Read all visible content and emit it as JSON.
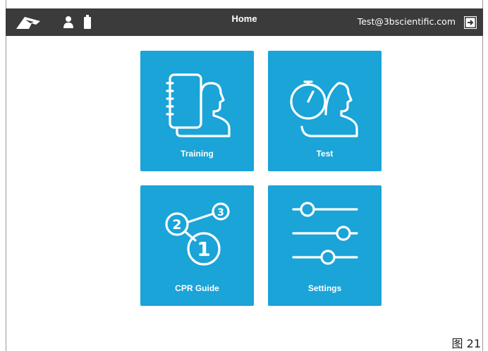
{
  "header": {
    "title": "Home",
    "email": "Test@3bscientific.com"
  },
  "tiles": [
    {
      "label": "Training",
      "icon": "training-icon"
    },
    {
      "label": "Test",
      "icon": "test-icon"
    },
    {
      "label": "CPR Guide",
      "icon": "cpr-guide-icon"
    },
    {
      "label": "Settings",
      "icon": "settings-icon"
    }
  ],
  "cpr_steps": [
    "1",
    "2",
    "3"
  ],
  "caption": "图 21",
  "colors": {
    "topbar": "#3b3b3b",
    "tile": "#1aa4d8"
  }
}
